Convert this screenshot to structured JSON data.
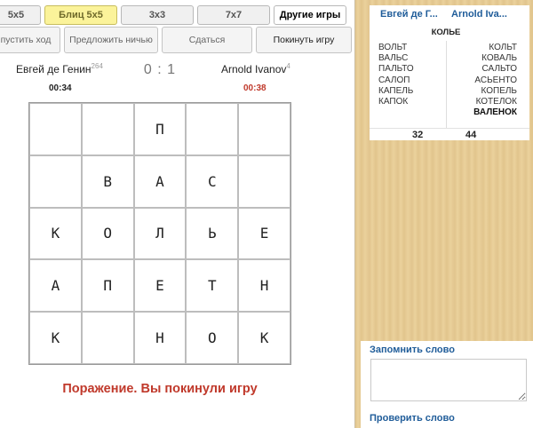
{
  "tabs": [
    {
      "label": "5x5"
    },
    {
      "label": "Блиц 5x5"
    },
    {
      "label": "3x3"
    },
    {
      "label": "7x7"
    },
    {
      "label": "Другие игры"
    }
  ],
  "actions": {
    "skip": "пустить ход",
    "offer_draw": "Предложить ничью",
    "surrender": "Сдаться",
    "leave": "Покинуть игру"
  },
  "players": {
    "left": {
      "name": "Евгей де Генин",
      "rating": "264",
      "timer": "00:34"
    },
    "right": {
      "name": "Arnold Ivanov",
      "rating": "4",
      "timer": "00:38"
    },
    "score": "0 : 1"
  },
  "board": [
    [
      "",
      "",
      "П",
      "",
      ""
    ],
    [
      "",
      "В",
      "А",
      "С",
      ""
    ],
    [
      "К",
      "О",
      "Л",
      "Ь",
      "Е"
    ],
    [
      "А",
      "П",
      "Е",
      "Т",
      "Н"
    ],
    [
      "К",
      "",
      "Н",
      "О",
      "К"
    ]
  ],
  "result": "Поражение. Вы покинули игру",
  "words": {
    "left_header": "Евгей де Г...",
    "right_header": "Arnold Iva...",
    "initial_word": "КОЛЬЕ",
    "left_words": [
      "ВОЛЬТ",
      "ВАЛЬС",
      "ПАЛЬТО",
      "САЛОП",
      "КАПЕЛЬ",
      "КАПОК"
    ],
    "right_words": [
      "КОЛЬТ",
      "КОВАЛЬ",
      "САЛЬТО",
      "АСЬЕНТО",
      "КОПЕЛЬ",
      "КОТЕЛОК"
    ],
    "right_last_word": "ВАЛЕНОК",
    "left_total": "32",
    "right_total": "44"
  },
  "memo": {
    "title": "Запомнить слово",
    "value": "",
    "check_link": "Проверить слово"
  }
}
